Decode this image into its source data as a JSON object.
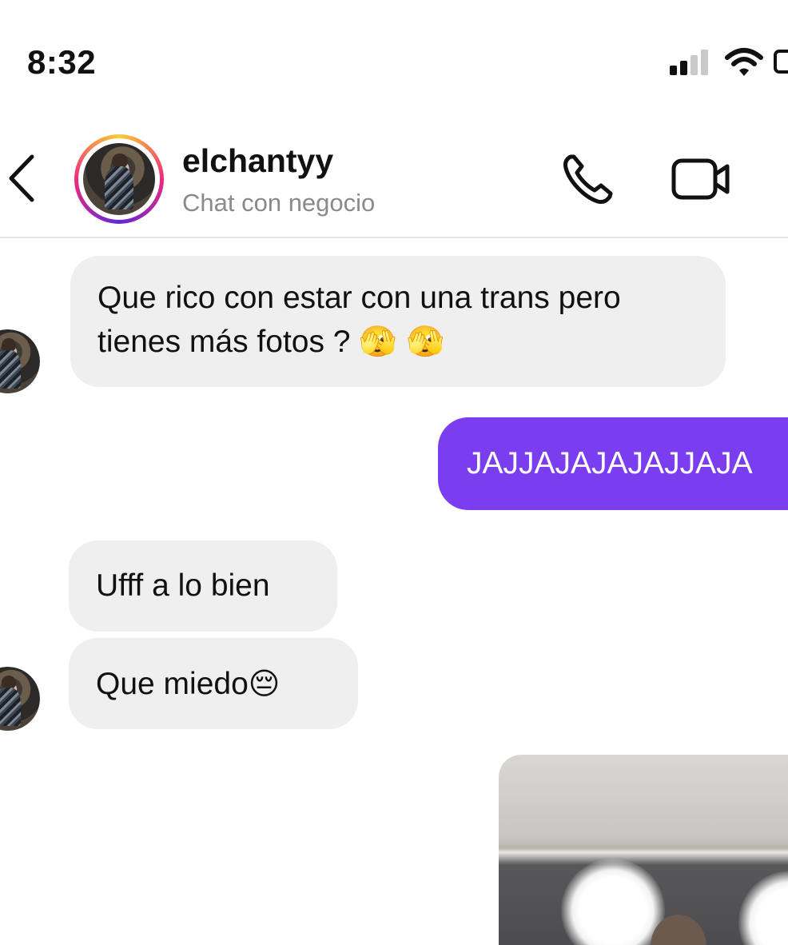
{
  "status_bar": {
    "time": "8:32"
  },
  "header": {
    "username": "elchantyy",
    "subtitle": "Chat con negocio",
    "back_icon": "chevron-left-icon",
    "call_icon": "phone-icon",
    "video_icon": "video-camera-icon"
  },
  "messages": [
    {
      "direction": "incoming",
      "line1": "Que rico con estar con una trans pero",
      "line2": "tienes más fotos ?",
      "emojis": "🫣 🫣"
    },
    {
      "direction": "outgoing",
      "text": "JAJJAJAJAJAJJAJA"
    },
    {
      "direction": "incoming",
      "text": "Ufff a lo bien"
    },
    {
      "direction": "incoming",
      "text": "Que miedo",
      "emoji": "😔"
    },
    {
      "direction": "outgoing",
      "type": "photo"
    }
  ],
  "colors": {
    "outgoing_bubble": "#7a3df0",
    "incoming_bubble": "#efefef",
    "subtitle_text": "#8a8a8a"
  }
}
